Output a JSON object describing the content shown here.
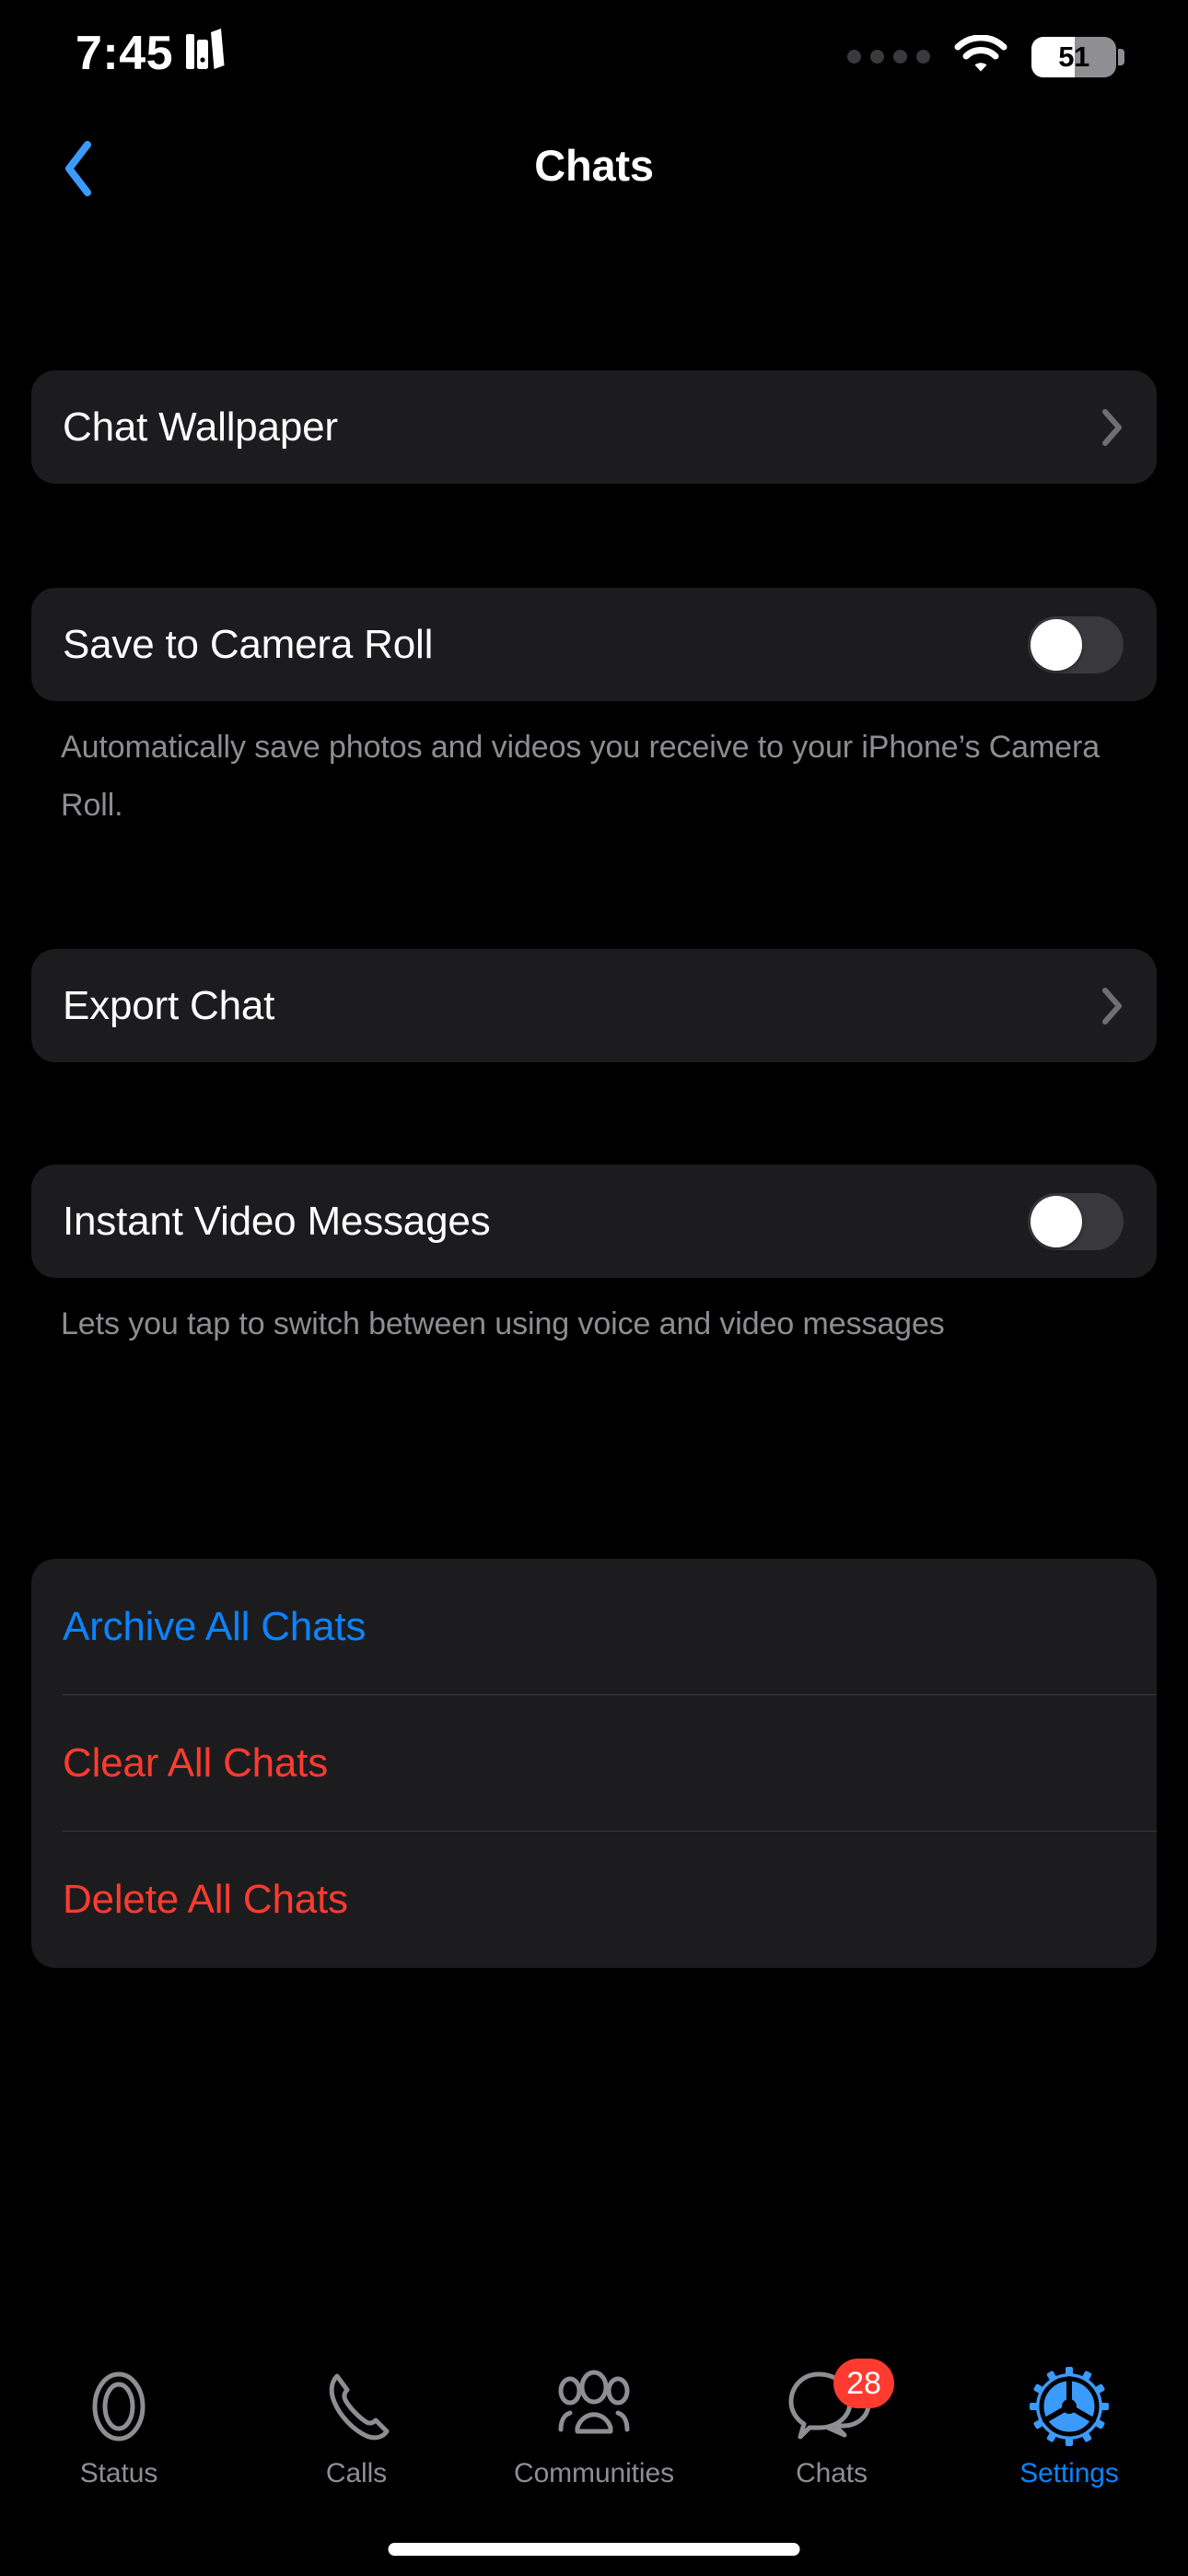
{
  "status_bar": {
    "time": "7:45",
    "app_indicator_icon": "books-icon",
    "signal_icon": "signal-dots-icon",
    "wifi_icon": "wifi-icon",
    "battery_percent": "51",
    "battery_level": 51
  },
  "nav": {
    "back_icon": "chevron-left-icon",
    "title": "Chats"
  },
  "sections": {
    "wallpaper": {
      "label": "Chat Wallpaper",
      "disclosure_icon": "chevron-right-icon"
    },
    "camera_roll": {
      "label": "Save to Camera Roll",
      "toggle_state": "off",
      "footnote": "Automatically save photos and videos you receive to your iPhone’s Camera Roll."
    },
    "export": {
      "label": "Export Chat",
      "disclosure_icon": "chevron-right-icon"
    },
    "instant_video": {
      "label": "Instant Video Messages",
      "toggle_state": "off",
      "footnote": "Lets you tap to switch between using voice and video messages"
    },
    "actions": [
      {
        "label": "Archive All Chats",
        "style": "blue"
      },
      {
        "label": "Clear All Chats",
        "style": "red"
      },
      {
        "label": "Delete All Chats",
        "style": "red"
      }
    ]
  },
  "tab_bar": {
    "items": [
      {
        "label": "Status",
        "icon": "status-rings-icon",
        "active": false,
        "badge": ""
      },
      {
        "label": "Calls",
        "icon": "phone-icon",
        "active": false,
        "badge": ""
      },
      {
        "label": "Communities",
        "icon": "communities-people-icon",
        "active": false,
        "badge": ""
      },
      {
        "label": "Chats",
        "icon": "chat-bubbles-icon",
        "active": false,
        "badge": "28"
      },
      {
        "label": "Settings",
        "icon": "gear-icon",
        "active": true,
        "badge": ""
      }
    ]
  },
  "colors": {
    "background": "#000000",
    "card": "#1c1c1e",
    "accent_blue": "#0a84ff",
    "destructive_red": "#ff3b30",
    "secondary_text": "#8d8d92",
    "toggle_track_off": "#39393d"
  }
}
